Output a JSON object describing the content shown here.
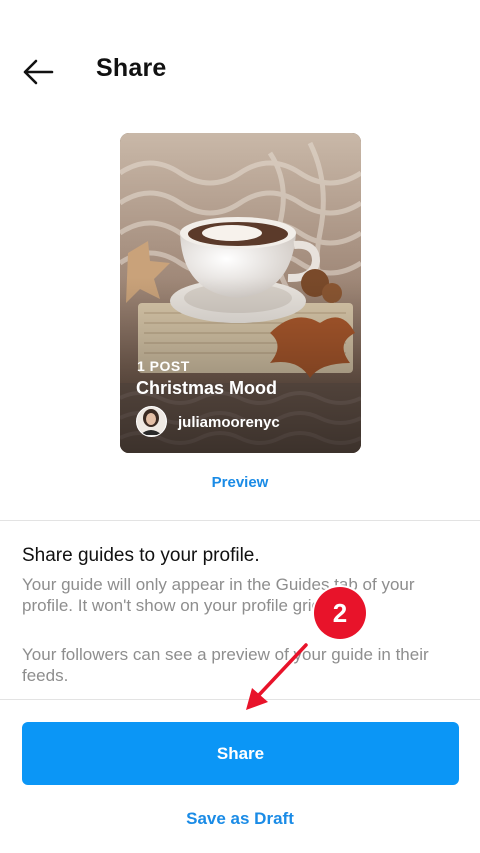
{
  "header": {
    "title": "Share",
    "back_icon": "arrow-left-icon"
  },
  "card": {
    "post_count": "1 POST",
    "title": "Christmas Mood",
    "username": "juliamoorenyc"
  },
  "preview_label": "Preview",
  "info": {
    "heading": "Share guides to your profile.",
    "body1": "Your guide will only appear in the Guides tab of your profile. It won't show on your profile grid.",
    "body2": "Your followers can see a preview of your guide in their feeds."
  },
  "share_button_label": "Share",
  "draft_label": "Save as Draft",
  "annotation": {
    "step": "2",
    "color": "#e8132a"
  },
  "colors": {
    "primary": "#0b96f6",
    "link": "#1a8be6",
    "muted": "#8e8e8e"
  }
}
